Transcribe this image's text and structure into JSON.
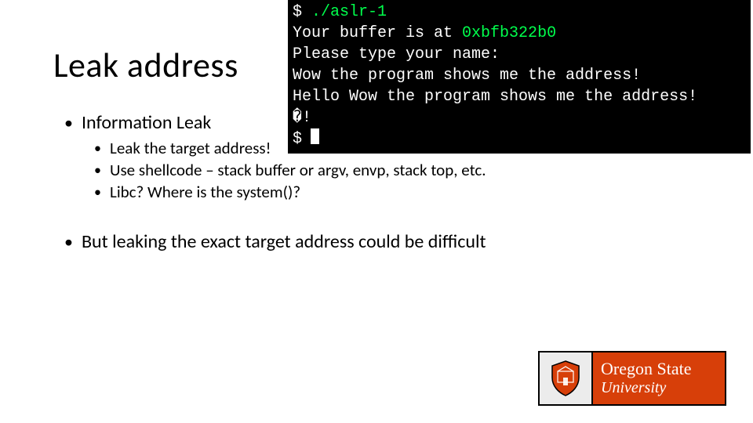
{
  "title": "Leak address",
  "bullets": {
    "b1": "Information Leak",
    "sub1": "Leak the target address!",
    "sub2": "Use shellcode – stack buffer or argv, envp, stack top, etc.",
    "sub3": "Libc? Where is the system()?",
    "b2": "But leaking the exact target address could be difficult"
  },
  "terminal": {
    "line1_prompt": "$ ",
    "line1_cmd": "./aslr-1",
    "line2a": "Your buffer is at ",
    "line2b": "0xbfb322b0",
    "line3": "Please type your name:",
    "line4": "Wow the program shows me the address!",
    "line5": "Hello Wow the program shows me the address!",
    "line6": "�!",
    "line7_prompt": "$ "
  },
  "logo": {
    "line1": "Oregon State",
    "line2": "University"
  }
}
